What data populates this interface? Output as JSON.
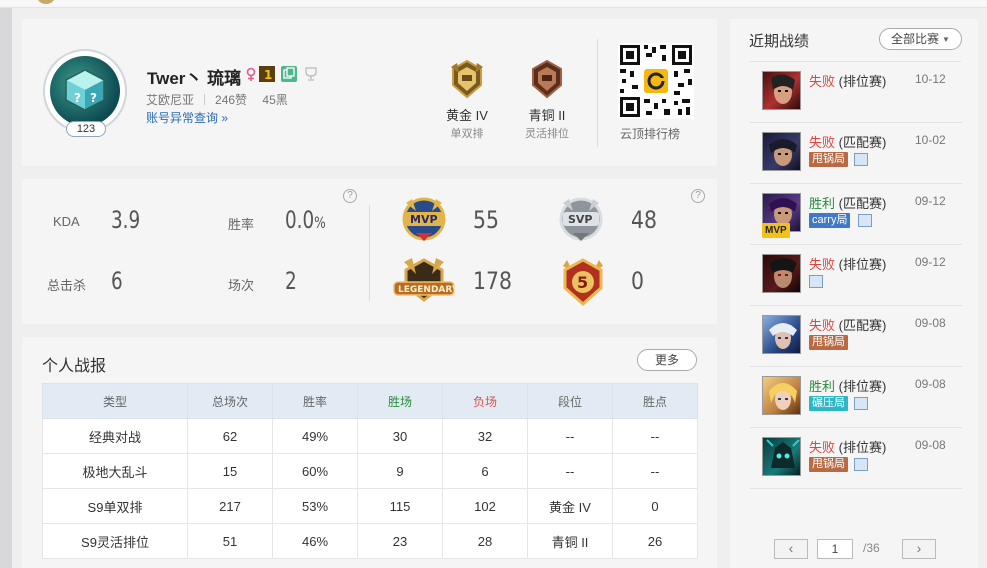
{
  "profile": {
    "name": "Twer丶 琉璃",
    "level": "123",
    "region": "艾欧尼亚",
    "likes": "246赞",
    "blacks": "45黑",
    "abnormal_link": "账号异常查询 »",
    "ranks": [
      {
        "name": "黄金 IV",
        "type": "单双排"
      },
      {
        "name": "青铜 II",
        "type": "灵活排位"
      }
    ],
    "qr_label": "云顶排行榜"
  },
  "stats": {
    "kda_label": "KDA",
    "kda": "3.9",
    "winrate_label": "胜率",
    "winrate": "0.0",
    "winrate_unit": "%",
    "kills_label": "总击杀",
    "kills": "6",
    "games_label": "场次",
    "games": "2",
    "help": "?",
    "badges": {
      "mvp": "55",
      "svp": "48",
      "legendary": "178",
      "penta": "0"
    }
  },
  "report": {
    "title": "个人战报",
    "more": "更多",
    "headers": [
      "类型",
      "总场次",
      "胜率",
      "胜场",
      "负场",
      "段位",
      "胜点"
    ],
    "rows": [
      [
        "经典对战",
        "62",
        "49%",
        "30",
        "32",
        "--",
        "--"
      ],
      [
        "极地大乱斗",
        "15",
        "60%",
        "9",
        "6",
        "--",
        "--"
      ],
      [
        "S9单双排",
        "217",
        "53%",
        "115",
        "102",
        "黄金 IV",
        "0"
      ],
      [
        "S9灵活排位",
        "51",
        "46%",
        "23",
        "28",
        "青铜 II",
        "26"
      ]
    ]
  },
  "recent": {
    "title": "近期战绩",
    "filter": "全部比赛",
    "matches": [
      {
        "result": "失败",
        "mode": "(排位赛)",
        "date": "10-12",
        "tag": ""
      },
      {
        "result": "失败",
        "mode": "(匹配赛)",
        "date": "10-02",
        "tag": "甩锅局"
      },
      {
        "result": "胜利",
        "mode": "(匹配赛)",
        "date": "09-12",
        "tag": "carry局"
      },
      {
        "result": "失败",
        "mode": "(排位赛)",
        "date": "09-12",
        "tag": ""
      },
      {
        "result": "失败",
        "mode": "(匹配赛)",
        "date": "09-08",
        "tag": "甩锅局"
      },
      {
        "result": "胜利",
        "mode": "(排位赛)",
        "date": "09-08",
        "tag": "碾压局"
      },
      {
        "result": "失败",
        "mode": "(排位赛)",
        "date": "09-08",
        "tag": "甩锅局"
      }
    ],
    "mvp_tag": "MVP",
    "pager": {
      "prev": "‹",
      "page": "1",
      "total": "/36",
      "next": "›"
    }
  },
  "colors": {
    "lose": "#e0443e",
    "win": "#2b8a3e",
    "link": "#2a6cb5",
    "table_header": "#e2ebf3"
  }
}
